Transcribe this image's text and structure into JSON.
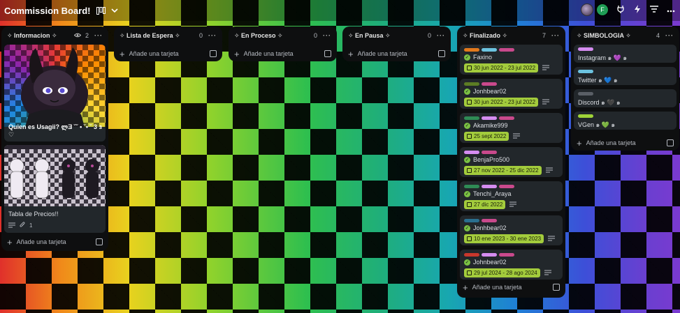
{
  "board": {
    "title": "Commission Board!",
    "view_icon": "board-view-icon",
    "chevron": "⌄"
  },
  "topbar_right": {
    "avatar_letter": "F",
    "icons": [
      "power-up-icon",
      "automation-icon",
      "filter-icon",
      "more-icon"
    ]
  },
  "lists": [
    {
      "title": "✧ Informacion ✧",
      "count": "2",
      "add_label": "Añade una tarjeta",
      "cards": [
        {
          "title": "Quien es Usagii? ლƎ ˘˘ • ˘• ˘ 3 з ♡"
        },
        {
          "title": "Tabla de Precios!!",
          "attachments": "1"
        }
      ]
    },
    {
      "title": "✧ Lista de Espera ✧",
      "count": "0",
      "add_label": "Añade una tarjeta"
    },
    {
      "title": "✧ En Proceso ✧",
      "count": "0",
      "add_label": "Añade una tarjeta"
    },
    {
      "title": "✧ En Pausa ✧",
      "count": "0",
      "add_label": "Añade una tarjeta"
    },
    {
      "title": "✧ Finalizado ✧",
      "count": "7",
      "add_label": "Añade una tarjeta",
      "cards": [
        {
          "labels": [
            "#e2791c",
            "#6cc3e0",
            "#c9498c"
          ],
          "title": "Faxino",
          "date": "30 jun 2022 - 23 jul 2022"
        },
        {
          "labels": [
            "#5c7c24",
            "#c9498c"
          ],
          "title": "Jonhbear02",
          "date": "30 jun 2022 - 23 jul 2022"
        },
        {
          "labels": [
            "#2f8a55",
            "#d58cf0",
            "#c9498c"
          ],
          "title": "Akamike999",
          "date": "25 sept 2022"
        },
        {
          "labels": [
            "#d58cf0",
            "#c9498c"
          ],
          "title": "BenjaPro500",
          "date": "27 nov 2022 - 25 dic 2022"
        },
        {
          "labels": [
            "#2f8a55",
            "#d58cf0",
            "#c9498c"
          ],
          "title": "Tenchi_Araya",
          "date": "27 dic 2022"
        },
        {
          "labels": [
            "#2a6f8f",
            "#c9498c"
          ],
          "title": "Jonhbear02",
          "date": "10 ene 2023 - 30 ene 2023"
        },
        {
          "labels": [
            "#c9372c",
            "#d58cf0",
            "#c9498c"
          ],
          "title": "Johnbear02",
          "date": "29 jul 2024 - 28 ago 2024"
        }
      ]
    },
    {
      "title": "✧ SIMBOLOGIA ✧",
      "count": "4",
      "add_label": "Añade una tarjeta",
      "cards": [
        {
          "label": "#d58cf0",
          "title": "Instagram ๑ 💜 ๑"
        },
        {
          "label": "#6cc3e0",
          "title": "Twitter ๑ 💙 ๑"
        },
        {
          "label": "#5a5f66",
          "title": "Discord ๑ 🖤 ๑"
        },
        {
          "label": "#9fd338",
          "title": "VGen ๑ 💚 ๑"
        }
      ]
    }
  ]
}
